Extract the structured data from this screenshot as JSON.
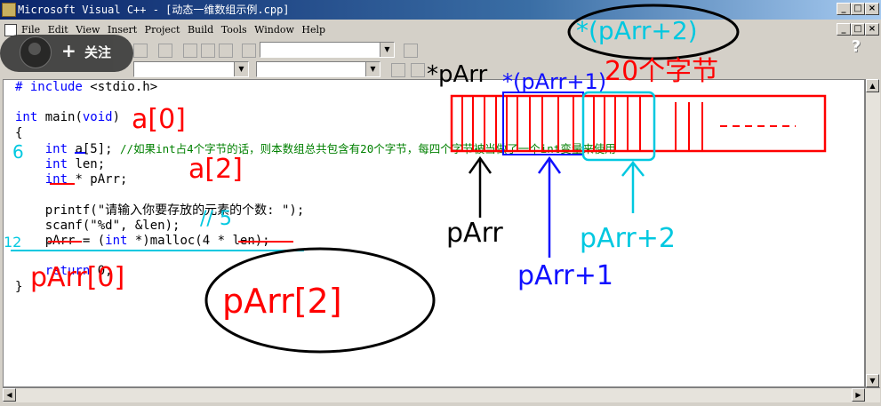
{
  "window": {
    "title": "Microsoft Visual C++ - [动态一维数组示例.cpp]",
    "controls": [
      "_",
      "□",
      "×"
    ],
    "mdi_controls": [
      "_",
      "□",
      "×"
    ]
  },
  "menu": {
    "items": [
      "File",
      "Edit",
      "View",
      "Insert",
      "Project",
      "Build",
      "Tools",
      "Window",
      "Help"
    ]
  },
  "overlay_badge": {
    "plus": "+",
    "label": "关注"
  },
  "code_lines": [
    "# include <stdio.h>",
    "",
    "int main(void)",
    "{",
    "    int a[5]; //如果int占4个字节的话，则本数组总共包含有20个字节，每四个字节被当做了一个int变量来使用",
    "    int len;",
    "    int * pArr;",
    "",
    "    printf(\"请输入你要存放的元素的个数: \");",
    "    scanf(\"%d\", &len);",
    "    pArr = (int *)malloc(4 * len);",
    "",
    "    return 0;",
    "}"
  ],
  "annotations": {
    "a0": "a[0]",
    "a2": "a[2]",
    "num6": "6",
    "num5": "// 5",
    "num12": "12",
    "parr0": "pArr[0]",
    "parr2": "pArr[2]",
    "star_parr": "*pArr",
    "star_parr1": "*(pArr+1)",
    "star_parr2": "*(pArr+2)",
    "twenty_bytes": "20个字节",
    "parr": "pArr",
    "parr_plus1": "pArr+1",
    "parr_plus2": "pArr+2"
  },
  "colors": {
    "titlebar_left": "#0a246a",
    "titlebar_right": "#a6caf0",
    "keyword": "#0000ff",
    "comment": "#008000",
    "ink_red": "#ff0000",
    "ink_blue": "#1010ff",
    "ink_cyan": "#00c8e0",
    "ink_black": "#000000"
  }
}
